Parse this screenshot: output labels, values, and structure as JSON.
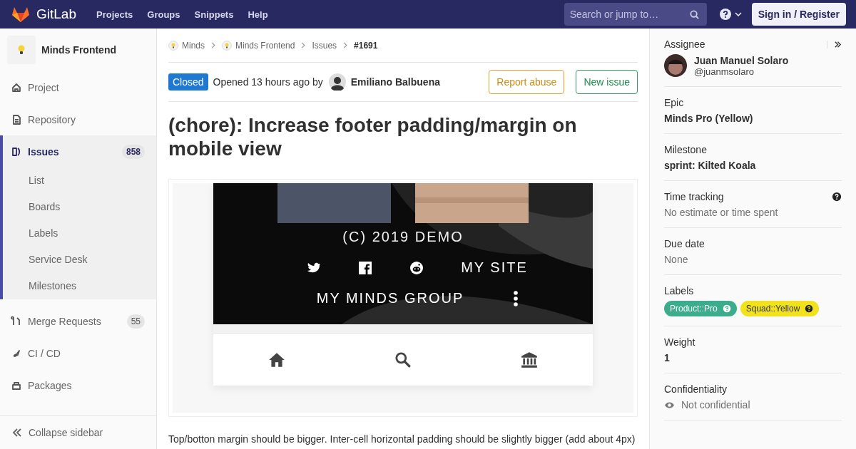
{
  "nav": {
    "brand": "GitLab",
    "links": [
      "Projects",
      "Groups",
      "Snippets",
      "Help"
    ],
    "search": {
      "placeholder": "Search or jump to…"
    },
    "sign_in": "Sign in / Register"
  },
  "sidebar": {
    "project": "Minds Frontend",
    "items": [
      {
        "label": "Project",
        "selected": false
      },
      {
        "label": "Repository",
        "selected": false
      },
      {
        "label": "Issues",
        "count": "858",
        "selected": true,
        "children": [
          {
            "label": "List",
            "selected": false
          },
          {
            "label": "Boards",
            "selected": false
          },
          {
            "label": "Labels",
            "selected": false
          },
          {
            "label": "Service Desk",
            "selected": false
          },
          {
            "label": "Milestones",
            "selected": false
          }
        ]
      },
      {
        "label": "Merge Requests",
        "count": "55",
        "selected": false
      },
      {
        "label": "CI / CD",
        "selected": false
      },
      {
        "label": "Packages",
        "selected": false
      }
    ],
    "collapse": "Collapse sidebar"
  },
  "breadcrumb": [
    "Minds",
    "Minds Frontend",
    "Issues",
    "#1691"
  ],
  "issue": {
    "status": "Closed",
    "opened": "Opened 13 hours ago by",
    "author": "Emiliano Balbuena",
    "buttons": [
      "Report abuse",
      "New issue"
    ],
    "title": "(chore): Increase footer padding/margin on mobile view",
    "attachment": {
      "copyright": "(C) 2019 DEMO",
      "link": "MY SITE",
      "group": "MY MINDS GROUP"
    },
    "description": "Top/botton margin should be bigger. Inter-cell horizontal padding should be slightly bigger (add about 4px)"
  },
  "details": {
    "assignee": {
      "title": "Assignee",
      "name": "Juan Manuel Solaro",
      "username": "@juanmsolaro"
    },
    "sections": [
      {
        "title": "Epic",
        "kind": "bold",
        "value": "Minds Pro (Yellow)",
        "help": false
      },
      {
        "title": "Milestone",
        "kind": "bold",
        "value": "sprint: Kilted Koala",
        "help": false
      },
      {
        "title": "Time tracking",
        "kind": "muted",
        "value": "No estimate or time spent",
        "help": true
      },
      {
        "title": "Due date",
        "kind": "muted",
        "value": "None",
        "help": false
      },
      {
        "title": "Labels",
        "kind": "labels",
        "help": false,
        "labels": [
          {
            "text": "Product::Pro",
            "color": "#3cad8c"
          },
          {
            "text": "Squad::Yellow",
            "color": "#f2e21d"
          }
        ]
      },
      {
        "title": "Weight",
        "kind": "bold",
        "value": "1",
        "help": false
      },
      {
        "title": "Confidentiality",
        "kind": "confidential",
        "value": "Not confidential",
        "help": false
      }
    ]
  }
}
